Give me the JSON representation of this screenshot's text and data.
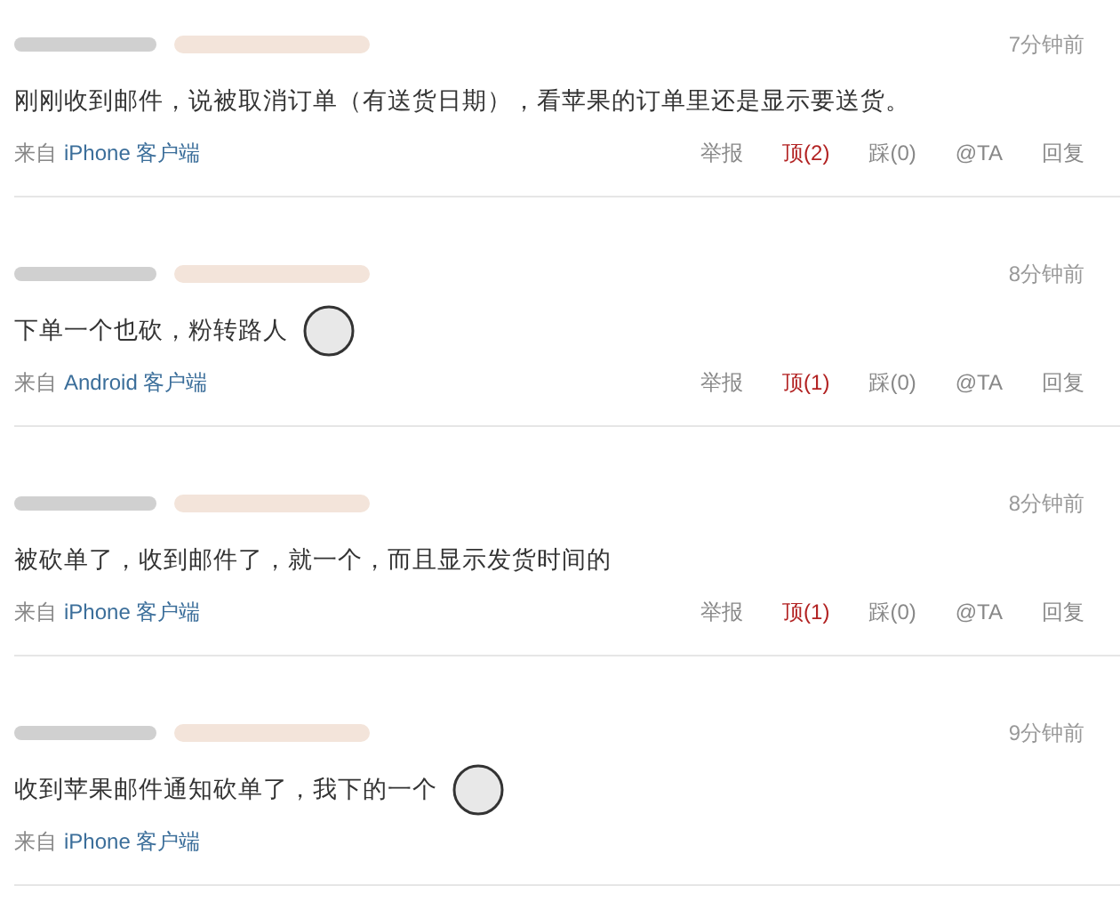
{
  "comments": [
    {
      "time": "7分钟前",
      "text": "刚刚收到邮件，说被取消订单（有送货日期），看苹果的订单里还是显示要送货。",
      "emoticon": false,
      "source_prefix": "来自",
      "source": "iPhone 客户端",
      "actions": [
        {
          "label": "举报",
          "kind": "plain"
        },
        {
          "label": "顶(2)",
          "kind": "up"
        },
        {
          "label": "踩(0)",
          "kind": "plain"
        },
        {
          "label": "@TA",
          "kind": "plain"
        },
        {
          "label": "回复",
          "kind": "plain"
        }
      ]
    },
    {
      "time": "8分钟前",
      "text": "下单一个也砍，粉转路人",
      "emoticon": true,
      "source_prefix": "来自",
      "source": "Android 客户端",
      "actions": [
        {
          "label": "举报",
          "kind": "plain"
        },
        {
          "label": "顶(1)",
          "kind": "up"
        },
        {
          "label": "踩(0)",
          "kind": "plain"
        },
        {
          "label": "@TA",
          "kind": "plain"
        },
        {
          "label": "回复",
          "kind": "plain"
        }
      ]
    },
    {
      "time": "8分钟前",
      "text": "被砍单了，收到邮件了，就一个，而且显示发货时间的",
      "emoticon": false,
      "source_prefix": "来自",
      "source": "iPhone 客户端",
      "actions": [
        {
          "label": "举报",
          "kind": "plain"
        },
        {
          "label": "顶(1)",
          "kind": "up"
        },
        {
          "label": "踩(0)",
          "kind": "plain"
        },
        {
          "label": "@TA",
          "kind": "plain"
        },
        {
          "label": "回复",
          "kind": "plain"
        }
      ]
    },
    {
      "time": "9分钟前",
      "text": "收到苹果邮件通知砍单了，我下的一个",
      "emoticon": true,
      "source_prefix": "来自",
      "source": "iPhone 客户端"
    }
  ]
}
